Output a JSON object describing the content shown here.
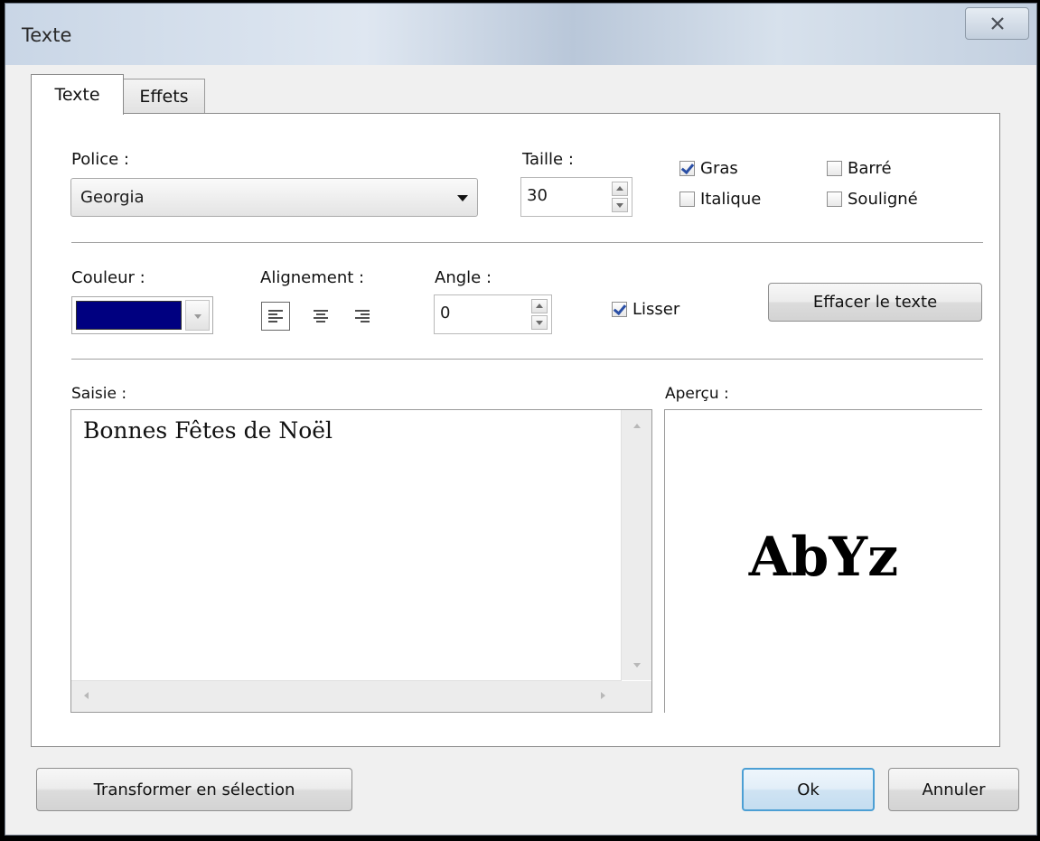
{
  "window": {
    "title": "Texte",
    "close_icon": "close-icon"
  },
  "tabs": [
    {
      "label": "Texte",
      "active": true
    },
    {
      "label": "Effets",
      "active": false
    }
  ],
  "font": {
    "label": "Police :",
    "value": "Georgia"
  },
  "size": {
    "label": "Taille :",
    "value": "30"
  },
  "styles": {
    "bold": {
      "label": "Gras",
      "checked": true
    },
    "italic": {
      "label": "Italique",
      "checked": false
    },
    "strikethrough": {
      "label": "Barré",
      "checked": false
    },
    "underline": {
      "label": "Souligné",
      "checked": false
    }
  },
  "color": {
    "label": "Couleur :",
    "value": "#000080"
  },
  "alignment": {
    "label": "Alignement :",
    "options": [
      "align-left-icon",
      "align-center-icon",
      "align-right-icon"
    ],
    "selected": "align-left-icon"
  },
  "angle": {
    "label": "Angle :",
    "value": "0"
  },
  "smooth": {
    "label": "Lisser",
    "checked": true
  },
  "clear_button": "Effacer le texte",
  "input": {
    "label": "Saisie :",
    "text": "Bonnes Fêtes de Noël"
  },
  "preview": {
    "label": "Aperçu :",
    "sample": "AbYz"
  },
  "buttons": {
    "transform": "Transformer en sélection",
    "ok": "Ok",
    "cancel": "Annuler"
  }
}
